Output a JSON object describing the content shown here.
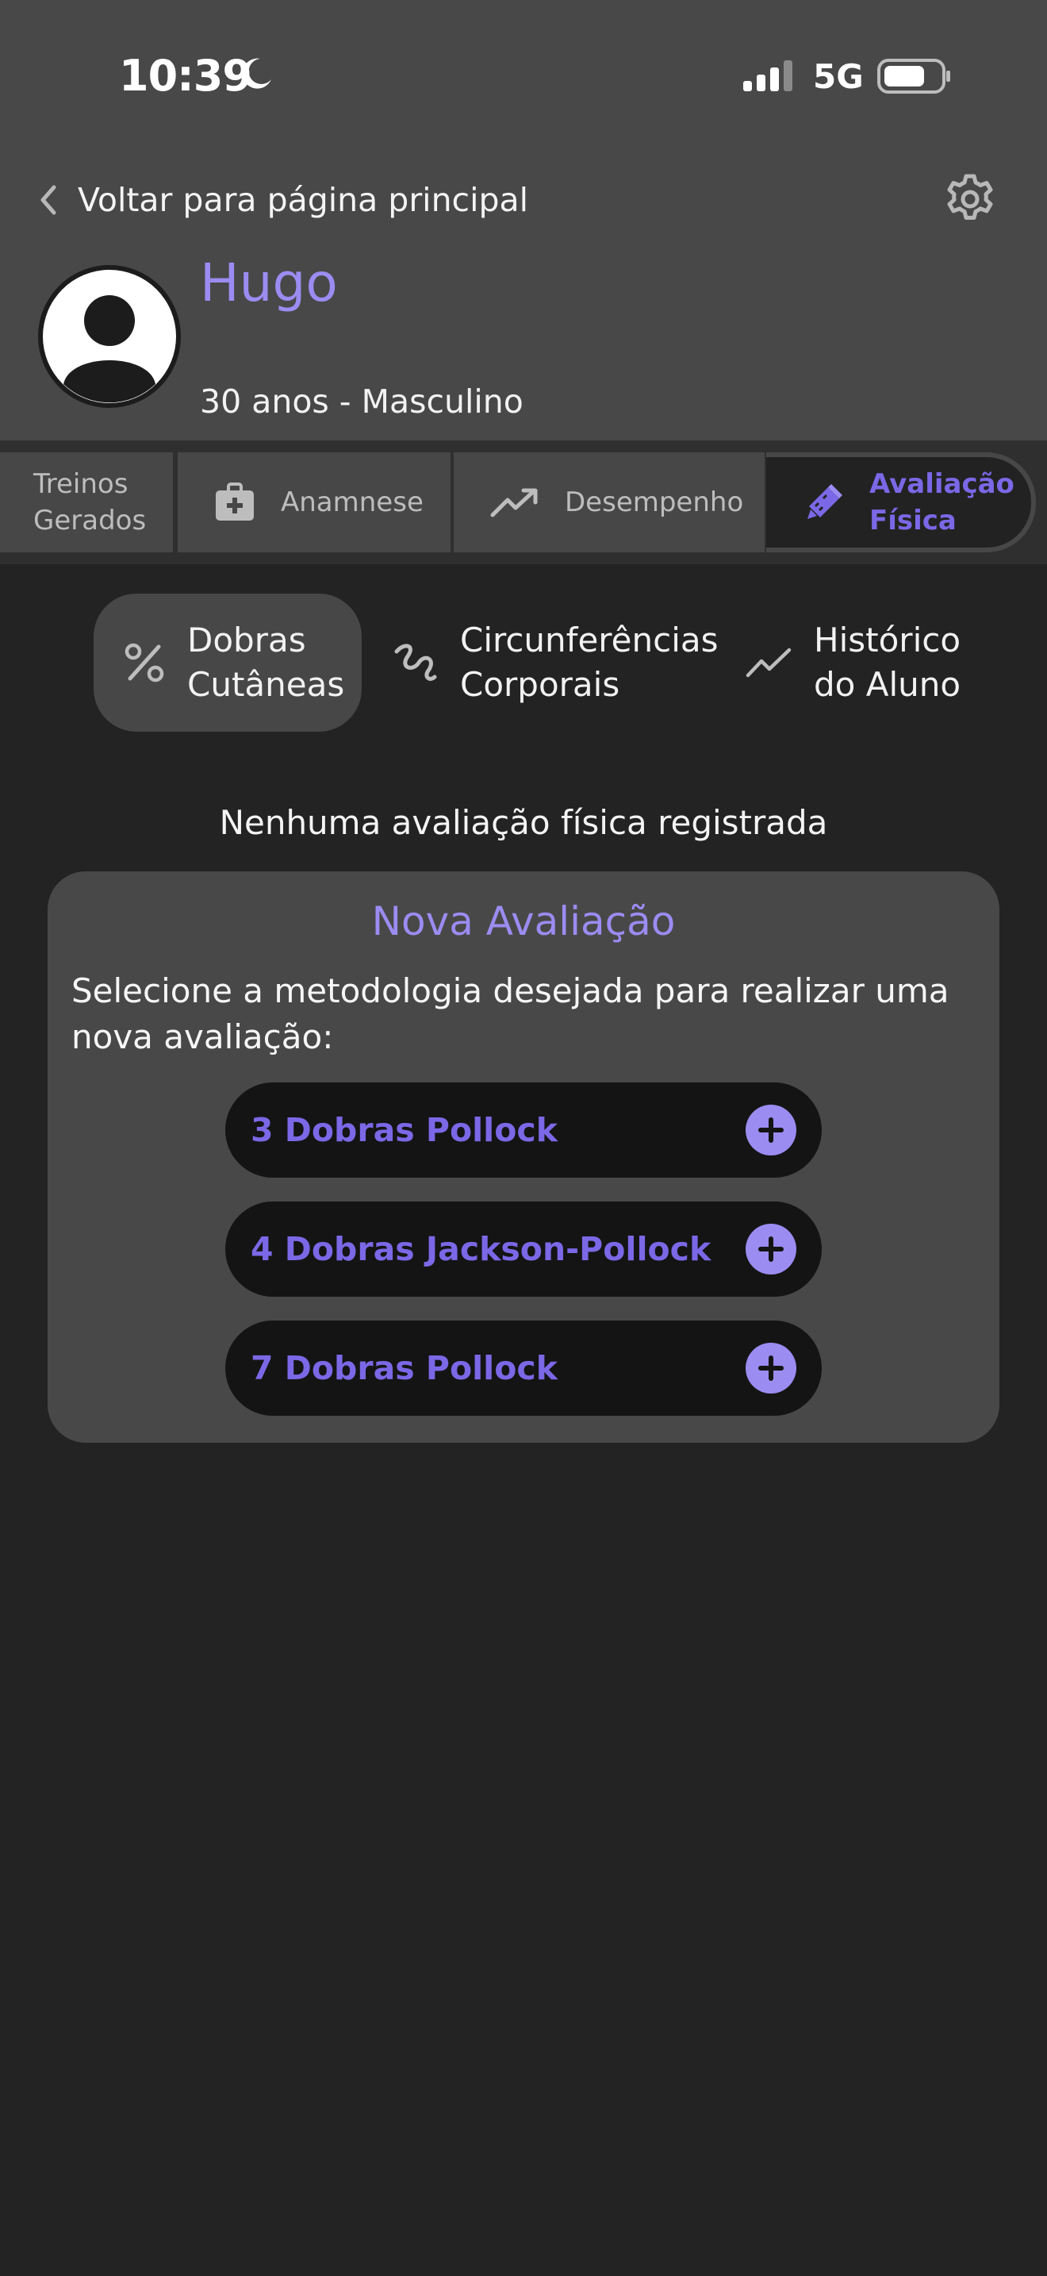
{
  "status_bar": {
    "time": "10:39",
    "network": "5G",
    "icons": [
      "moon-icon",
      "signal-icon",
      "battery-icon"
    ]
  },
  "nav": {
    "back_label": "Voltar para página principal",
    "back_icon": "chevron-left-icon",
    "settings_icon": "gear-icon"
  },
  "profile": {
    "name": "Hugo",
    "details": "30 anos - Masculino",
    "avatar_icon": "user-icon"
  },
  "tabs": [
    {
      "label": "Treinos Gerados",
      "line1": "Treinos",
      "line2": "Gerados",
      "icon": "dumbbell-icon"
    },
    {
      "label": "Anamnese",
      "icon": "medical-kit-icon"
    },
    {
      "label": "Desempenho",
      "icon": "trending-up-icon"
    },
    {
      "label": "Avaliação Física",
      "line1": "Avaliação",
      "line2": "Física",
      "icon": "pencil-ruler-icon",
      "active": true
    }
  ],
  "subtabs": [
    {
      "line1": "Dobras",
      "line2": "Cutâneas",
      "icon": "percent-icon",
      "active": true
    },
    {
      "line1": "Circunferências",
      "line2": "Corporais",
      "icon": "measuring-tape-icon"
    },
    {
      "line1": "Histórico",
      "line2": "do Aluno",
      "icon": "chart-line-icon"
    }
  ],
  "empty_message": "Nenhuma avaliação física registrada",
  "new_evaluation": {
    "title": "Nova Avaliação",
    "description": "Selecione a metodologia desejada para realizar uma nova avaliação:",
    "methods": [
      {
        "label": "3 Dobras Pollock"
      },
      {
        "label": "4 Dobras Jackson-Pollock"
      },
      {
        "label": "7 Dobras Pollock"
      }
    ],
    "add_icon": "plus-circle-icon"
  },
  "colors": {
    "accent": "#9b8cf2",
    "accent_dark": "#7a68e6",
    "header_bg": "#484848",
    "page_bg": "#232323"
  }
}
